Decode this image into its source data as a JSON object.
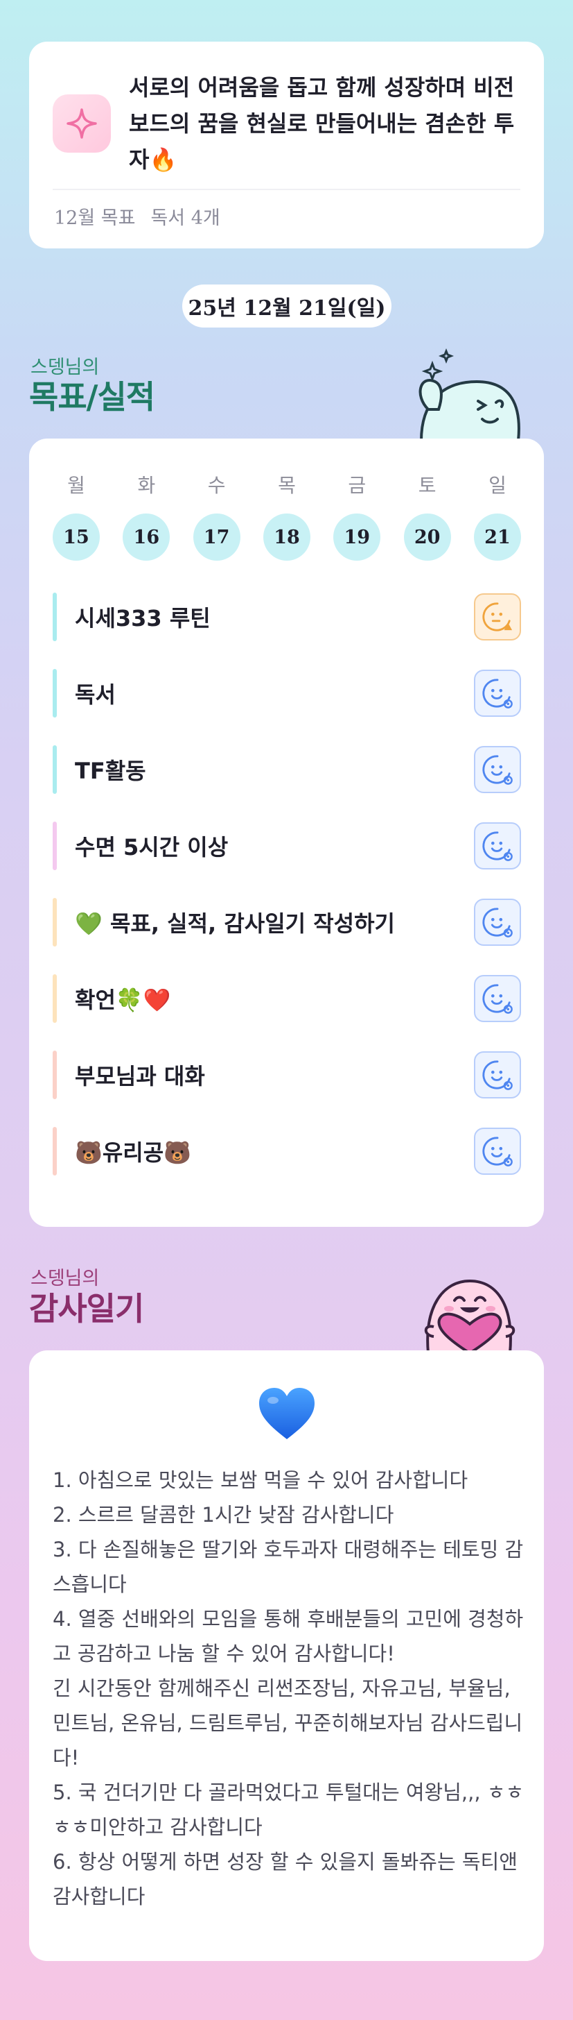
{
  "goal": {
    "text": "서로의 어려움을 돕고 함께 성장하며 비전보드의 꿈을 현실로 만들어내는 겸손한 투자🔥",
    "month_label": "12월 목표",
    "reading_label": "독서 4개"
  },
  "date_label": "25년 12월 21일(일)",
  "goals_section": {
    "subtitle": "스뎅님의",
    "title": "목표/실적"
  },
  "week": {
    "days": [
      "월",
      "화",
      "수",
      "목",
      "금",
      "토",
      "일"
    ],
    "dates": [
      "15",
      "16",
      "17",
      "18",
      "19",
      "20",
      "21"
    ]
  },
  "tasks": [
    {
      "label": "시세333 루틴",
      "bar_color": "#a9ecef",
      "status": "warning"
    },
    {
      "label": "독서",
      "bar_color": "#a9ecef",
      "status": "done"
    },
    {
      "label": "TF활동",
      "bar_color": "#a9ecef",
      "status": "done"
    },
    {
      "label": "수면 5시간 이상",
      "bar_color": "#f4c9ef",
      "status": "done"
    },
    {
      "label": "💚 목표, 실적, 감사일기 작성하기",
      "bar_color": "#fde3bc",
      "status": "done"
    },
    {
      "label": "확언🍀❤️",
      "bar_color": "#fde3bc",
      "status": "done"
    },
    {
      "label": "부모님과 대화",
      "bar_color": "#fbd1c8",
      "status": "done"
    },
    {
      "label": "🐻유리공🐻",
      "bar_color": "#fbd1c8",
      "status": "done"
    }
  ],
  "diary_section": {
    "subtitle": "스뎅님의",
    "title": "감사일기"
  },
  "diary": {
    "heart": "💙",
    "text": "1. 아침으로 맛있는 보쌈 먹을 수 있어 감사합니다\n2. 스르르 달콤한 1시간 낮잠 감사합니다\n3. 다 손질해놓은 딸기와 호두과자 대령해주는 테토밍 감스흡니다\n4. 열중 선배와의 모임을 통해 후배분들의 고민에 경청하고 공감하고 나눔 할 수 있어 감사합니다!\n긴 시간동안 함께해주신 리썬조장님, 자유고님, 부율님, 민트님, 온유님, 드림트루님, 꾸준히해보자님 감사드립니다!\n5. 국 건더기만 다 골라먹었다고 투털대는 여왕님,,, ㅎㅎㅎㅎ미안하고 감사합니다\n6. 항상 어떻게 하면 성장 할 수 있을지 돌봐쥬는 독티앤 감사합니다"
  },
  "colors": {
    "warning_bg": "#fff0dc",
    "warning_border": "#f6c98d",
    "warning_icon": "#f0a43d",
    "done_bg": "#ecf3ff",
    "done_border": "#b7cdfb",
    "done_icon": "#4f86f0"
  }
}
